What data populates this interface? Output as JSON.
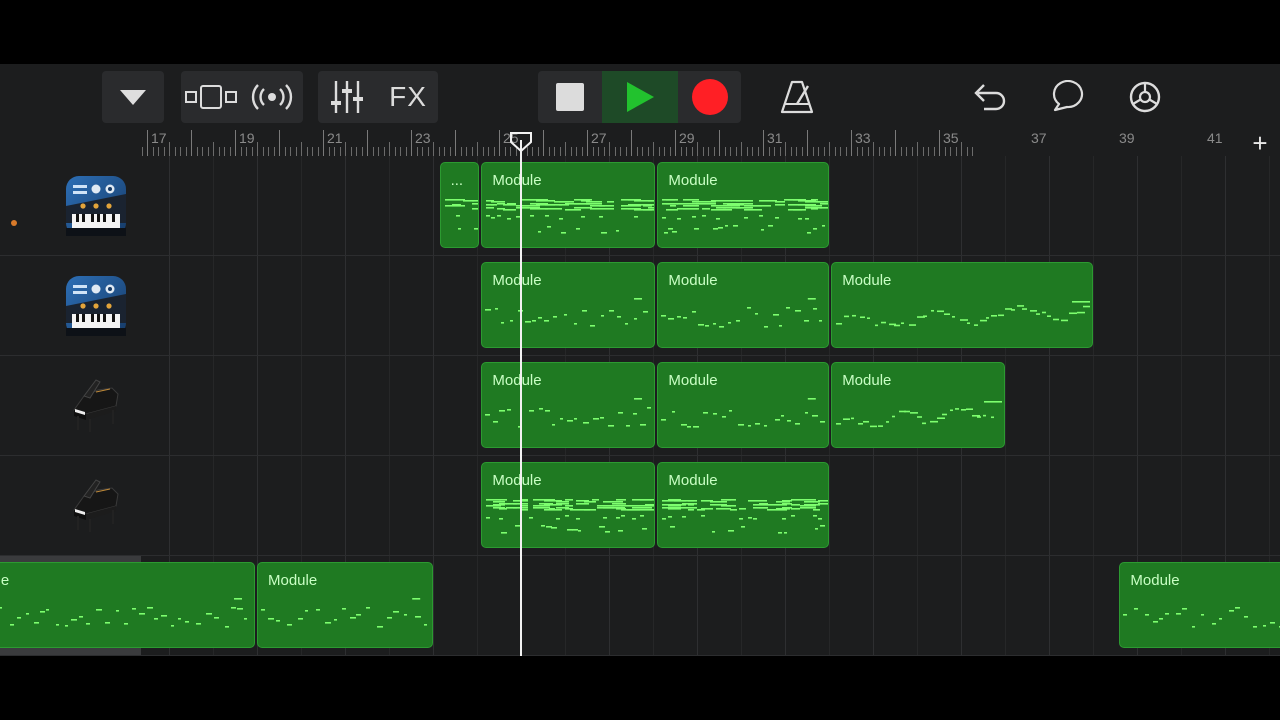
{
  "toolbar": {
    "fx_label": "FX"
  },
  "ruler": {
    "bar_numbers": [
      "17",
      "19",
      "21",
      "23",
      "25",
      "27",
      "29",
      "31",
      "33",
      "35",
      "37",
      "39",
      "41"
    ],
    "add_track_label": "+"
  },
  "tracks": [
    {
      "instrument_icon": "synth-keyboard-icon",
      "regions": [
        {
          "label": "...",
          "start_bar": 23.15,
          "end_bar": 24.1,
          "pattern": "dense"
        },
        {
          "label": "Module",
          "start_bar": 24.1,
          "end_bar": 28.1,
          "pattern": "dense"
        },
        {
          "label": "Module",
          "start_bar": 28.1,
          "end_bar": 32.05,
          "pattern": "dense"
        }
      ]
    },
    {
      "instrument_icon": "synth-keyboard-icon",
      "regions": [
        {
          "label": "Module",
          "start_bar": 24.1,
          "end_bar": 28.1,
          "pattern": "sparse"
        },
        {
          "label": "Module",
          "start_bar": 28.1,
          "end_bar": 32.05,
          "pattern": "sparse"
        },
        {
          "label": "Module",
          "start_bar": 32.05,
          "end_bar": 38.05,
          "pattern": "melody"
        }
      ]
    },
    {
      "instrument_icon": "grand-piano-icon",
      "regions": [
        {
          "label": "Module",
          "start_bar": 24.1,
          "end_bar": 28.1,
          "pattern": "sparse"
        },
        {
          "label": "Module",
          "start_bar": 28.1,
          "end_bar": 32.05,
          "pattern": "sparse"
        },
        {
          "label": "Module",
          "start_bar": 32.05,
          "end_bar": 36.05,
          "pattern": "melody"
        }
      ]
    },
    {
      "instrument_icon": "grand-piano-icon",
      "regions": [
        {
          "label": "Module",
          "start_bar": 24.1,
          "end_bar": 28.1,
          "pattern": "dense"
        },
        {
          "label": "Module",
          "start_bar": 28.1,
          "end_bar": 32.05,
          "pattern": "dense"
        }
      ]
    },
    {
      "instrument_icon": "synth-keyboard-icon",
      "selected": true,
      "regions": [
        {
          "label": "Module",
          "start_bar": 12.0,
          "end_bar": 19.0,
          "pattern": "sparse"
        },
        {
          "label": "Module",
          "start_bar": 19.0,
          "end_bar": 23.05,
          "pattern": "sparse"
        },
        {
          "label": "Module",
          "start_bar": 38.6,
          "end_bar": 43.0,
          "pattern": "sparse"
        }
      ]
    }
  ],
  "playhead_bar": 25,
  "colors": {
    "region_fill": "#1f7a22",
    "region_border": "#2c9a31",
    "region_text": "#c9ffc4",
    "note": "#7dff6e",
    "play": "#22c22e",
    "record": "#ff1f25",
    "rec_enable_dot": "#d87a2a"
  }
}
